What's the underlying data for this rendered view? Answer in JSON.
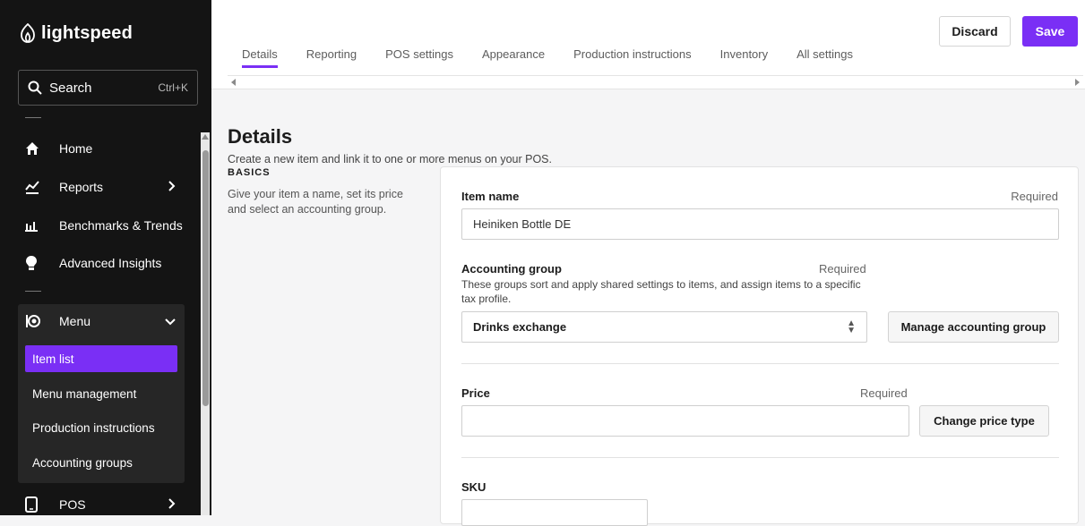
{
  "brand": {
    "name": "lightspeed"
  },
  "search": {
    "label": "Search",
    "shortcut": "Ctrl+K"
  },
  "sidebar": {
    "items": [
      {
        "label": "Home",
        "icon": "home-icon"
      },
      {
        "label": "Reports",
        "icon": "reports-icon"
      },
      {
        "label": "Benchmarks & Trends",
        "icon": "benchmarks-icon"
      },
      {
        "label": "Advanced Insights",
        "icon": "lightbulb-icon"
      }
    ],
    "menu": {
      "label": "Menu",
      "icon": "menu-icon",
      "subitems": [
        {
          "label": "Item list",
          "active": true
        },
        {
          "label": "Menu management",
          "active": false
        },
        {
          "label": "Production instructions",
          "active": false
        },
        {
          "label": "Accounting groups",
          "active": false
        }
      ]
    },
    "pos": {
      "label": "POS",
      "icon": "tablet-icon"
    }
  },
  "tabs": [
    "Details",
    "Reporting",
    "POS settings",
    "Appearance",
    "Production instructions",
    "Inventory",
    "All settings"
  ],
  "actions": {
    "discard": "Discard",
    "save": "Save"
  },
  "page": {
    "title": "Details",
    "subtitle": "Create a new item and link it to one or more menus on your POS.",
    "section": "BASICS",
    "section_desc": "Give your item a name, set its price and select an accounting group."
  },
  "form": {
    "item_name": {
      "label": "Item name",
      "required": "Required",
      "value": "Heiniken Bottle DE"
    },
    "accounting_group": {
      "label": "Accounting group",
      "required": "Required",
      "help": "These groups sort and apply shared settings to items, and assign items to a specific tax profile.",
      "value": "Drinks exchange",
      "manage_button": "Manage accounting group"
    },
    "price": {
      "label": "Price",
      "required": "Required",
      "value": "",
      "change_button": "Change price type"
    },
    "sku": {
      "label": "SKU",
      "value": ""
    }
  },
  "colors": {
    "accent": "#7a2ff5",
    "sidebar_bg": "#141414"
  }
}
